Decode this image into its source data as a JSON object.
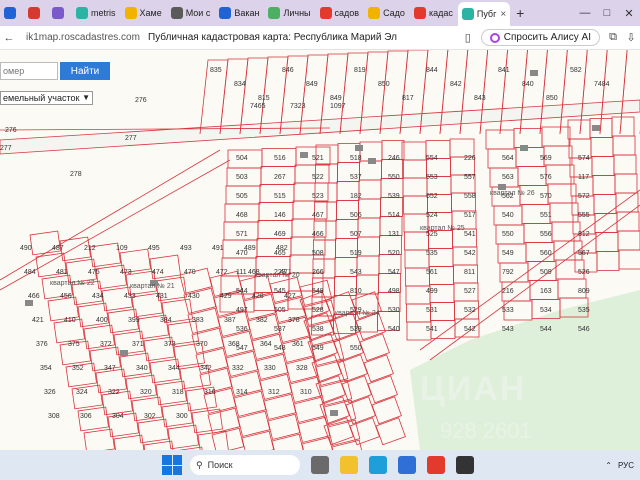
{
  "browser": {
    "tabs": [
      {
        "label": "",
        "color": "#1f63d4"
      },
      {
        "label": "",
        "color": "#d43a2f"
      },
      {
        "label": "",
        "color": "#7a5acb"
      },
      {
        "label": "metris",
        "color": "#2bb3a4"
      },
      {
        "label": "Хаме",
        "color": "#f2b300"
      },
      {
        "label": "Мои с",
        "color": "#5a5a5a"
      },
      {
        "label": "Вакан",
        "color": "#1f63d4"
      },
      {
        "label": "Личны",
        "color": "#4bb063"
      },
      {
        "label": "садов",
        "color": "#e23b2e"
      },
      {
        "label": "Садо",
        "color": "#f2b300"
      },
      {
        "label": "кадас",
        "color": "#e23b2e"
      },
      {
        "label": "Пубг",
        "color": "#2bb3a4",
        "active": true
      }
    ],
    "new_tab": "+",
    "url": "ik1map.roscadastres.com",
    "page_title": "Публичная кадастровая карта: Республика Марий Эл",
    "alice_button": "Спросить Алису AI"
  },
  "map": {
    "search_placeholder": "омер",
    "find_button": "Найти",
    "type_select": "емельный участок",
    "watermark": "ЦИАН",
    "watermark_phone": "928 2601",
    "accent_color": "#2d7bd6",
    "boundary_color": "#d9343d",
    "labels_top": [
      "835",
      "834",
      "815",
      "846",
      "849",
      "849",
      "819",
      "850",
      "817",
      "844",
      "842",
      "843",
      "841",
      "840",
      "850",
      "582",
      "7484",
      "7465",
      "7323",
      "1097",
      "276",
      "276",
      "277",
      "277",
      "278"
    ],
    "labels_mid": [
      "504",
      "516",
      "521",
      "518",
      "246",
      "554",
      "226",
      "564",
      "569",
      "574",
      "503",
      "267",
      "522",
      "537",
      "550",
      "553",
      "557",
      "563",
      "576",
      "117",
      "505",
      "515",
      "523",
      "182",
      "539",
      "552",
      "558",
      "562",
      "570",
      "572",
      "468",
      "146",
      "467",
      "506",
      "514",
      "524",
      "517",
      "540",
      "551",
      "555",
      "571",
      "469",
      "466",
      "507",
      "131",
      "525",
      "541",
      "550",
      "556",
      "812",
      "470",
      "465",
      "508",
      "519",
      "520",
      "535",
      "542",
      "549",
      "560",
      "567",
      "111",
      "223",
      "266",
      "543",
      "547",
      "561",
      "811",
      "792",
      "509",
      "526",
      "544",
      "545",
      "548",
      "810",
      "498",
      "499",
      "527",
      "216",
      "163",
      "809",
      "497",
      "505",
      "528",
      "529",
      "530",
      "531",
      "532",
      "533",
      "534",
      "535",
      "536",
      "537",
      "538",
      "539",
      "540",
      "541",
      "542",
      "543",
      "544",
      "546",
      "547",
      "548",
      "549",
      "550"
    ],
    "labels_low": [
      "490",
      "487",
      "212",
      "109",
      "495",
      "493",
      "491",
      "489",
      "482",
      "484",
      "481",
      "475",
      "473",
      "474",
      "470",
      "472",
      "468",
      "471",
      "466",
      "456",
      "434",
      "433",
      "431",
      "430",
      "429",
      "428",
      "427",
      "421",
      "410",
      "400",
      "399",
      "384",
      "383",
      "387",
      "382",
      "378",
      "376",
      "375",
      "372",
      "371",
      "373",
      "370",
      "368",
      "364",
      "361",
      "354",
      "352",
      "347",
      "340",
      "344",
      "342",
      "332",
      "330",
      "328",
      "326",
      "324",
      "322",
      "320",
      "318",
      "316",
      "314",
      "312",
      "310",
      "308",
      "306",
      "304",
      "302",
      "300"
    ],
    "quarter_labels": [
      "квартал № 26",
      "квартал № 25",
      "квартал № 20",
      "квартал № 22",
      "квартал № 24",
      "квартал № 21"
    ]
  },
  "taskbar": {
    "search_label": "Поиск",
    "lang": "РУС",
    "apps": [
      {
        "name": "task-view",
        "color": "#6a6a6a"
      },
      {
        "name": "files",
        "color": "#f2c12e"
      },
      {
        "name": "edge",
        "color": "#1e9fd9"
      },
      {
        "name": "store",
        "color": "#2f6fd6"
      },
      {
        "name": "yandex-browser",
        "color": "#e23b2e"
      },
      {
        "name": "terminal",
        "color": "#333333"
      }
    ]
  }
}
